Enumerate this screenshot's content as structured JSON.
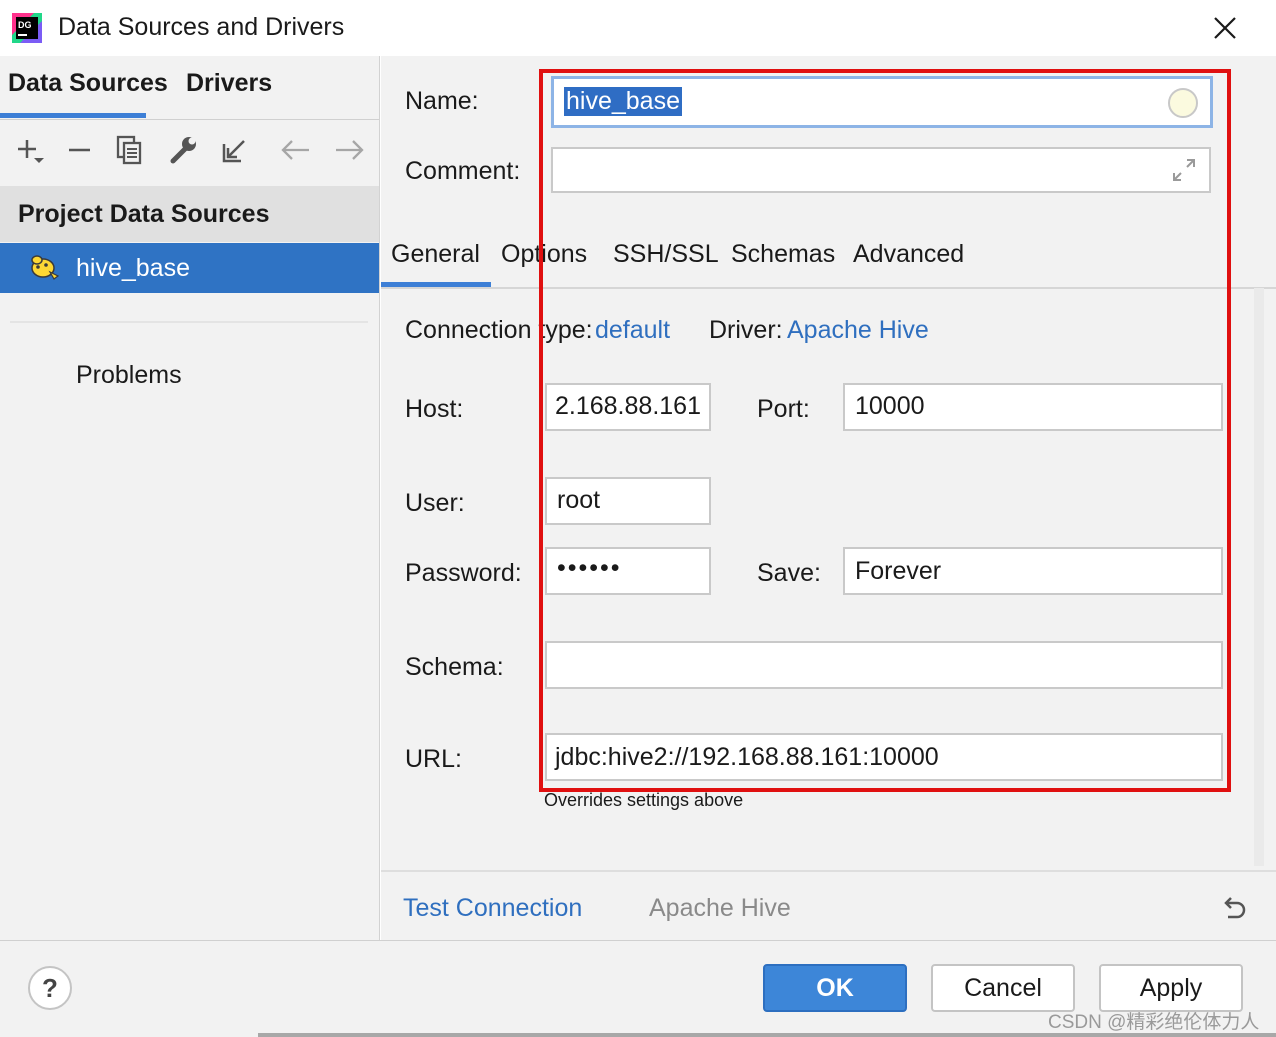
{
  "window": {
    "title": "Data Sources and Drivers",
    "app_icon": "datagrip-icon",
    "app_icon_text": "DG"
  },
  "sidebar": {
    "tabs": [
      {
        "label": "Data Sources",
        "active": true
      },
      {
        "label": "Drivers",
        "active": false
      }
    ],
    "toolbar": [
      "add-icon",
      "remove-icon",
      "duplicate-icon",
      "wrench-icon",
      "import-icon",
      "back-arrow-icon",
      "forward-arrow-icon"
    ],
    "group_title": "Project Data Sources",
    "items": [
      {
        "label": "hive_base",
        "icon": "hive-icon",
        "selected": true
      }
    ],
    "problems_label": "Problems"
  },
  "form": {
    "name_label": "Name:",
    "name_value": "hive_base",
    "comment_label": "Comment:",
    "comment_value": "",
    "tabs": [
      "General",
      "Options",
      "SSH/SSL",
      "Schemas",
      "Advanced"
    ],
    "connection_type_label": "Connection type:",
    "connection_type_value": "default",
    "driver_label": "Driver:",
    "driver_value": "Apache Hive",
    "host_label": "Host:",
    "host_value": "2.168.88.161",
    "port_label": "Port:",
    "port_value": "10000",
    "user_label": "User:",
    "user_value": "root",
    "password_label": "Password:",
    "password_value": "••••••",
    "save_label": "Save:",
    "save_value": "Forever",
    "schema_label": "Schema:",
    "schema_value": "",
    "url_label": "URL:",
    "url_value": "jdbc:hive2://192.168.88.161:10000",
    "url_helper": "Overrides settings above"
  },
  "bottom_bar": {
    "test_connection": "Test Connection",
    "driver_name": "Apache Hive"
  },
  "footer": {
    "help": "?",
    "ok": "OK",
    "cancel": "Cancel",
    "apply": "Apply",
    "watermark": "CSDN @精彩绝伦体力人"
  },
  "colors": {
    "accent": "#3d7fd6",
    "selection": "#2f73c4",
    "link": "#2f6fbf",
    "highlight_frame": "#e01010"
  }
}
